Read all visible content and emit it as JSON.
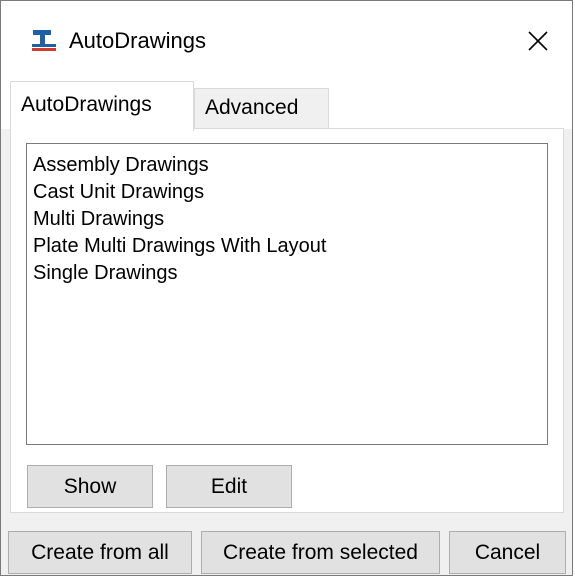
{
  "window": {
    "title": "AutoDrawings",
    "app_icon": "autodrawings-app-icon",
    "close_icon": "close-icon"
  },
  "tabs": [
    {
      "label": "AutoDrawings",
      "selected": true
    },
    {
      "label": "Advanced",
      "selected": false
    }
  ],
  "drawing_list": {
    "items": [
      "Assembly Drawings",
      "Cast Unit Drawings",
      "Multi Drawings",
      "Plate Multi Drawings With Layout",
      "Single Drawings"
    ]
  },
  "panel_buttons": {
    "show": "Show",
    "edit": "Edit"
  },
  "footer_buttons": {
    "create_from_all": "Create from all",
    "create_from_selected": "Create from selected",
    "cancel": "Cancel"
  },
  "colors": {
    "icon_blue": "#1f5fa8",
    "icon_red": "#d23a2f",
    "button_face": "#e1e1e1",
    "dialog_background": "#f0f0f0"
  }
}
